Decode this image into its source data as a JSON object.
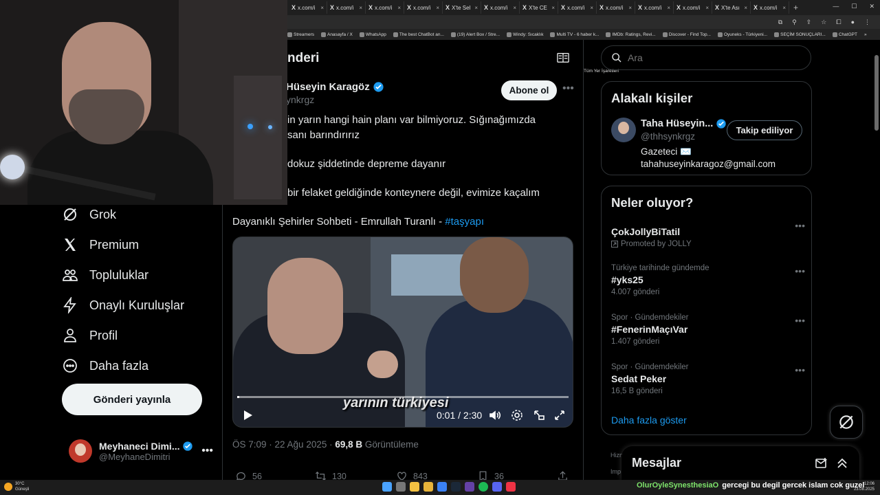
{
  "browser": {
    "tabs": [
      "x.com/i",
      "x.com/i",
      "x.com/i",
      "x.com/i",
      "X'te Sel",
      "x.com/i",
      "X'te CE",
      "x.com/i",
      "x.com/i",
      "x.com/i",
      "x.com/i",
      "X'te Ası",
      "x.com/i"
    ],
    "bookmarks": [
      "Streamers",
      "Anasayfa / X",
      "WhatsApp",
      "The best ChatBot an...",
      "(19) Alert Box / Stre...",
      "Windy: Sıcaklık",
      "Multi TV - 6 haber k...",
      "IMDb: Ratings, Revi...",
      "Discover - Find Top...",
      "Oyuneks - Türkiyeni...",
      "SEÇİM SONUÇLARI...",
      "ChatGPT"
    ],
    "bookmarks_more": "»",
    "all_bookmarks": "Tüm Yer İşaretleri"
  },
  "sidebar": {
    "items": [
      {
        "label": "Grok",
        "icon": "grok-icon"
      },
      {
        "label": "Premium",
        "icon": "x-logo-icon"
      },
      {
        "label": "Topluluklar",
        "icon": "communities-icon"
      },
      {
        "label": "Onaylı Kuruluşlar",
        "icon": "lightning-icon"
      },
      {
        "label": "Profil",
        "icon": "person-icon"
      },
      {
        "label": "Daha fazla",
        "icon": "more-circle-icon"
      }
    ],
    "post_button": "Gönderi yayınla",
    "account": {
      "name": "Meyhaneci Dimi...",
      "handle": "@MeyhaneDimitri",
      "more": "•••"
    }
  },
  "main": {
    "header_title": "nderi",
    "author": {
      "name": "Hüseyin Karagöz",
      "handle": "ynkrgz",
      "follow_label": "Abone ol",
      "more": "•••"
    },
    "tweet": {
      "line1": "in yarın hangi hain planı var bilmiyoruz. Sığınağımızda",
      "line2": "sanı barındırırız",
      "line3": "dokuz şiddetinde depreme dayanır",
      "line4": "bir felaket geldiğinde konteynere değil, evimize kaçalım",
      "line5_text": "Dayanıklı Şehirler Sohbeti - Emrullah Turanlı - ",
      "line5_hashtag": "#taşyapı"
    },
    "video": {
      "caption": "yarının türkiyesi",
      "time": "0:01 / 2:30",
      "progress": 0.007
    },
    "meta": {
      "time": "ÖS 7:09 · 22 Ağu 2025 · ",
      "views_count": "69,8 B",
      "views_label": " Görüntüleme"
    },
    "actions": {
      "replies": "56",
      "reposts": "130",
      "likes": "843",
      "bookmarks": "36"
    }
  },
  "right": {
    "search_placeholder": "Ara",
    "related": {
      "title": "Alakalı kişiler",
      "person": {
        "name": "Taha Hüseyin...",
        "handle": "@thhsynkrgz",
        "follow_label": "Takip ediliyor",
        "bio_line1": "Gazeteci ✉️",
        "bio_line2": "tahahuseyinkaragoz@gmail.com"
      }
    },
    "trends": {
      "title": "Neler oluyor?",
      "items": [
        {
          "context": "",
          "title": "ÇokJollyBiTatil",
          "sub": "Promoted by JOLLY"
        },
        {
          "context": "Türkiye tarihinde gündemde",
          "title": "#yks25",
          "sub": "4.007 gönderi"
        },
        {
          "context": "Spor · Gündemdekiler",
          "title": "#FenerinMaçıVar",
          "sub": "1.407 gönderi"
        },
        {
          "context": "Spor · Gündemdekiler",
          "title": "Sedat Peker",
          "sub": "16,5 B gönderi"
        }
      ],
      "show_more": "Daha fazla göster"
    },
    "side_peek": [
      "Hizn",
      "Imp"
    ]
  },
  "messages": {
    "title": "Mesajlar"
  },
  "taskbar": {
    "weather_temp": "30°C",
    "weather_desc": "Güneşli",
    "clock_time": "12:06",
    "clock_date": "23.08.2025"
  },
  "chat_overlay": {
    "user": "OlurOyleSynesthesiaO",
    "message": "gercegi bu degil gercek islam cok guzel"
  },
  "colors": {
    "accent": "#1d9bf0",
    "bg": "#000000",
    "border": "#2f3336",
    "muted": "#71767b"
  }
}
